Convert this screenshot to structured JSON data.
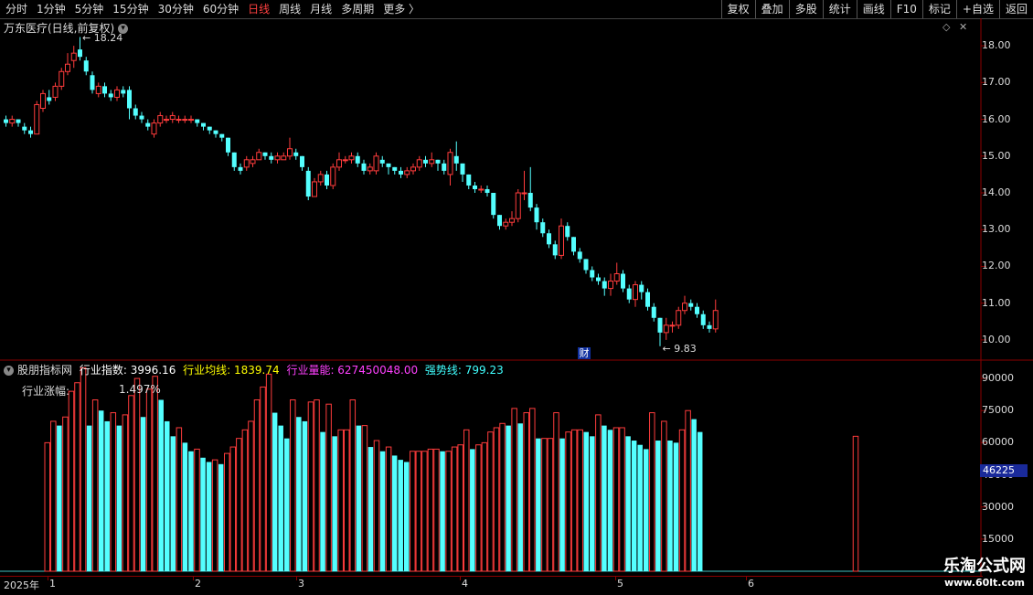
{
  "toolbar": {
    "periods": [
      "分时",
      "1分钟",
      "5分钟",
      "15分钟",
      "30分钟",
      "60分钟",
      "日线",
      "周线",
      "月线",
      "多周期",
      "更多 〉"
    ],
    "active_period": "日线",
    "right_buttons": [
      "复权",
      "叠加",
      "多股",
      "统计",
      "画线",
      "F10",
      "标记",
      "+自选",
      "返回"
    ]
  },
  "price_panel": {
    "title": "万东医疗(日线,前复权)",
    "high_marker": "18.24",
    "low_marker": "9.83",
    "event_label": "财",
    "y_ticks": [
      "18.00",
      "17.00",
      "16.00",
      "15.00",
      "14.00",
      "13.00",
      "12.00",
      "11.00",
      "10.00"
    ]
  },
  "indicator_panel": {
    "name": "股朋指标网",
    "items": [
      {
        "label": "行业指数:",
        "value": "3996.16",
        "color": "#ffffff"
      },
      {
        "label": "行业均线:",
        "value": "1839.74",
        "color": "#ffff00"
      },
      {
        "label": "行业量能:",
        "value": "627450048.00",
        "color": "#ff40ff"
      },
      {
        "label": "强势线:",
        "value": "799.23",
        "color": "#40ffff"
      }
    ],
    "sub_label": "行业涨幅:",
    "sub_value": "1.497%",
    "y_ticks": [
      "90000",
      "75000",
      "60000",
      "45000",
      "30000",
      "15000"
    ],
    "current_value": "46225"
  },
  "date_axis": {
    "year": "2025年",
    "months": [
      "1",
      "2",
      "3",
      "4",
      "5",
      "6"
    ]
  },
  "watermark": {
    "line1": "乐淘公式网",
    "line2": "www.60lt.com"
  },
  "colors": {
    "up": "#ff3c3c",
    "down": "#54ffff",
    "axis": "#8b0000"
  },
  "chart_data": [
    {
      "type": "candlestick",
      "y_range": [
        9.6,
        18.5
      ],
      "series": [
        {
          "values": [
            [
              16.0,
              15.9,
              16.1,
              15.8
            ],
            [
              15.9,
              16.0,
              16.1,
              15.8
            ],
            [
              16.0,
              15.9,
              16.0,
              15.8
            ],
            [
              15.8,
              15.7,
              15.9,
              15.6
            ],
            [
              15.7,
              15.6,
              15.8,
              15.5
            ],
            [
              15.6,
              16.4,
              16.5,
              15.6
            ],
            [
              16.3,
              16.7,
              16.8,
              16.2
            ],
            [
              16.6,
              16.5,
              16.8,
              16.4
            ],
            [
              16.6,
              16.9,
              17.0,
              16.5
            ],
            [
              16.9,
              17.3,
              17.4,
              16.8
            ],
            [
              17.3,
              17.5,
              17.8,
              17.2
            ],
            [
              17.6,
              17.8,
              18.0,
              17.4
            ],
            [
              17.9,
              17.7,
              18.24,
              17.6
            ],
            [
              17.6,
              17.3,
              17.7,
              17.2
            ],
            [
              17.2,
              16.8,
              17.3,
              16.7
            ],
            [
              16.7,
              16.9,
              17.0,
              16.6
            ],
            [
              16.9,
              16.7,
              17.0,
              16.6
            ],
            [
              16.7,
              16.6,
              16.8,
              16.5
            ],
            [
              16.6,
              16.8,
              16.9,
              16.5
            ],
            [
              16.8,
              16.7,
              16.9,
              16.6
            ],
            [
              16.8,
              16.3,
              16.9,
              16.0
            ],
            [
              16.3,
              16.1,
              16.4,
              16.0
            ],
            [
              16.1,
              16.0,
              16.2,
              15.9
            ],
            [
              15.9,
              15.8,
              16.0,
              15.7
            ],
            [
              15.6,
              15.9,
              16.0,
              15.5
            ],
            [
              15.9,
              16.1,
              16.2,
              15.8
            ],
            [
              16.0,
              16.0,
              16.1,
              15.9
            ],
            [
              16.0,
              16.1,
              16.2,
              15.9
            ],
            [
              16.0,
              16.0,
              16.1,
              15.9
            ],
            [
              16.0,
              16.0,
              16.1,
              15.9
            ],
            [
              16.0,
              16.0,
              16.1,
              15.9
            ],
            [
              16.0,
              15.9,
              16.0,
              15.8
            ],
            [
              15.9,
              15.8,
              15.9,
              15.7
            ],
            [
              15.8,
              15.7,
              15.8,
              15.6
            ],
            [
              15.7,
              15.6,
              15.7,
              15.5
            ],
            [
              15.6,
              15.5,
              15.6,
              15.4
            ],
            [
              15.5,
              15.1,
              15.5,
              15.0
            ],
            [
              15.1,
              14.7,
              15.1,
              14.6
            ],
            [
              14.7,
              14.6,
              14.8,
              14.5
            ],
            [
              14.7,
              14.9,
              15.0,
              14.6
            ],
            [
              14.8,
              14.9,
              15.0,
              14.7
            ],
            [
              14.9,
              15.1,
              15.2,
              14.9
            ],
            [
              15.1,
              15.0,
              15.1,
              14.9
            ],
            [
              15.0,
              14.9,
              15.1,
              14.8
            ],
            [
              14.9,
              15.0,
              15.1,
              14.8
            ],
            [
              14.9,
              15.0,
              15.1,
              14.9
            ],
            [
              15.0,
              15.2,
              15.5,
              14.9
            ],
            [
              15.1,
              15.0,
              15.2,
              14.9
            ],
            [
              15.0,
              14.7,
              15.0,
              14.6
            ],
            [
              14.6,
              13.9,
              14.7,
              13.8
            ],
            [
              13.9,
              14.3,
              14.4,
              13.9
            ],
            [
              14.3,
              14.5,
              14.6,
              14.2
            ],
            [
              14.5,
              14.2,
              14.6,
              14.1
            ],
            [
              14.2,
              14.7,
              14.8,
              14.1
            ],
            [
              14.7,
              14.9,
              15.1,
              14.6
            ],
            [
              14.9,
              14.9,
              15.0,
              14.8
            ],
            [
              14.9,
              15.0,
              15.1,
              14.8
            ],
            [
              15.0,
              14.8,
              15.1,
              14.7
            ],
            [
              14.8,
              14.6,
              14.9,
              14.5
            ],
            [
              14.6,
              14.7,
              14.8,
              14.5
            ],
            [
              14.6,
              15.0,
              15.1,
              14.5
            ],
            [
              14.9,
              14.8,
              15.0,
              14.7
            ],
            [
              14.8,
              14.7,
              14.8,
              14.5
            ],
            [
              14.7,
              14.6,
              14.7,
              14.5
            ],
            [
              14.6,
              14.5,
              14.7,
              14.4
            ],
            [
              14.5,
              14.6,
              14.7,
              14.4
            ],
            [
              14.6,
              14.7,
              14.8,
              14.5
            ],
            [
              14.7,
              14.9,
              15.0,
              14.6
            ],
            [
              14.9,
              14.8,
              15.0,
              14.7
            ],
            [
              14.8,
              14.9,
              15.1,
              14.7
            ],
            [
              14.9,
              14.8,
              14.9,
              14.6
            ],
            [
              14.8,
              14.6,
              14.9,
              14.5
            ],
            [
              14.5,
              15.1,
              15.2,
              14.2
            ],
            [
              15.0,
              14.8,
              15.4,
              14.6
            ],
            [
              14.8,
              14.5,
              14.8,
              14.3
            ],
            [
              14.5,
              14.2,
              14.5,
              14.1
            ],
            [
              14.2,
              14.1,
              14.3,
              14.0
            ],
            [
              14.1,
              14.1,
              14.2,
              14.0
            ],
            [
              14.1,
              14.0,
              14.2,
              13.9
            ],
            [
              14.0,
              13.4,
              14.0,
              13.3
            ],
            [
              13.4,
              13.1,
              13.4,
              13.0
            ],
            [
              13.1,
              13.2,
              13.3,
              13.0
            ],
            [
              13.2,
              13.3,
              13.5,
              13.1
            ],
            [
              13.3,
              14.0,
              14.1,
              13.2
            ],
            [
              14.0,
              14.0,
              14.6,
              13.8
            ],
            [
              14.0,
              13.6,
              14.7,
              13.5
            ],
            [
              13.6,
              13.2,
              13.7,
              13.0
            ],
            [
              13.2,
              12.9,
              13.3,
              12.8
            ],
            [
              12.9,
              12.6,
              13.0,
              12.5
            ],
            [
              12.6,
              12.3,
              12.7,
              12.2
            ],
            [
              12.3,
              13.1,
              13.3,
              12.2
            ],
            [
              13.1,
              12.8,
              13.2,
              12.7
            ],
            [
              12.8,
              12.4,
              12.8,
              12.3
            ],
            [
              12.4,
              12.2,
              12.5,
              12.1
            ],
            [
              12.2,
              11.9,
              12.2,
              11.8
            ],
            [
              11.9,
              11.7,
              12.0,
              11.6
            ],
            [
              11.7,
              11.6,
              11.8,
              11.5
            ],
            [
              11.6,
              11.4,
              11.7,
              11.2
            ],
            [
              11.4,
              11.6,
              11.8,
              11.2
            ],
            [
              11.6,
              11.8,
              12.1,
              11.5
            ],
            [
              11.8,
              11.4,
              11.9,
              11.3
            ],
            [
              11.4,
              11.1,
              11.5,
              11.0
            ],
            [
              11.1,
              11.5,
              11.6,
              10.9
            ],
            [
              11.5,
              11.3,
              11.6,
              11.1
            ],
            [
              11.3,
              10.9,
              11.4,
              10.8
            ],
            [
              10.9,
              10.6,
              11.0,
              10.5
            ],
            [
              10.6,
              10.2,
              10.6,
              9.83
            ],
            [
              10.2,
              10.4,
              10.6,
              10.0
            ],
            [
              10.4,
              10.4,
              10.5,
              10.2
            ],
            [
              10.4,
              10.8,
              10.9,
              10.3
            ],
            [
              10.8,
              11.0,
              11.2,
              10.7
            ],
            [
              11.0,
              10.9,
              11.1,
              10.8
            ],
            [
              10.9,
              10.7,
              11.0,
              10.6
            ],
            [
              10.7,
              10.4,
              10.8,
              10.3
            ],
            [
              10.4,
              10.3,
              10.5,
              10.2
            ],
            [
              10.3,
              10.8,
              11.1,
              10.2
            ]
          ]
        }
      ]
    },
    {
      "type": "bar",
      "y_range": [
        0,
        96000
      ],
      "series": [
        {
          "values": [
            0,
            0,
            0,
            0,
            0,
            0,
            0,
            0,
            0,
            0,
            0,
            0,
            60000,
            70000,
            68000,
            72000,
            84000,
            88000,
            95000,
            68000,
            80000,
            75000,
            70000,
            74000,
            68000,
            73000,
            82000,
            90000,
            72000,
            85000,
            91000,
            80000,
            70000,
            63000,
            67000,
            60000,
            56000,
            57000,
            53000,
            51000,
            52000,
            50000,
            55000,
            58000,
            62000,
            66000,
            70000,
            80000,
            86000,
            92000,
            74000,
            68000,
            62000,
            80000,
            72000,
            70000,
            79000,
            80000,
            65000,
            78000,
            63000,
            66000,
            66000,
            80000,
            68000,
            68000,
            58000,
            61000,
            56000,
            58000,
            54000,
            52000,
            51000,
            56000,
            56000,
            56000,
            57000,
            57000,
            56000,
            56000,
            58000,
            59000,
            66000,
            57000,
            59000,
            60000,
            65000,
            67000,
            69000,
            68000,
            76000,
            69000,
            74000,
            76000,
            62000,
            62000,
            62000,
            74000,
            62000,
            65000,
            66000,
            66000,
            65000,
            63000,
            73000,
            68000,
            66000,
            67000,
            67000,
            63000,
            61000,
            59000,
            57000,
            74000,
            61000,
            70000,
            61000,
            60000,
            66000,
            75000,
            71000,
            65000,
            0,
            0,
            0,
            0,
            0,
            0,
            0,
            0,
            0,
            0,
            0,
            0,
            0,
            0,
            0,
            0,
            0,
            0,
            0,
            0,
            0,
            0,
            0,
            0,
            0,
            63000
          ]
        }
      ]
    }
  ]
}
